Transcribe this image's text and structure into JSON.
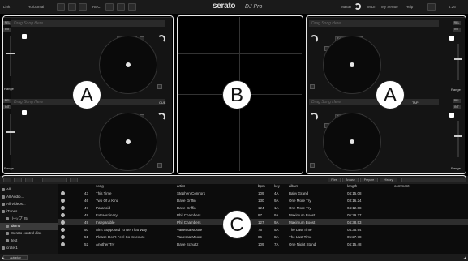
{
  "topbar": {
    "link": "Link",
    "layout": "Horizontal",
    "rec": "REC",
    "brand": "serato",
    "brand2": "DJ Pro",
    "master": "Master",
    "midi": "MIDI",
    "serato_db": "My Serato",
    "help": "Help",
    "clock": "4:26"
  },
  "decks": [
    {
      "title": "Drag Song Here",
      "rel": "REL",
      "int": "INT",
      "sync": "SYNC",
      "range": "Range",
      "extra": ""
    },
    {
      "title": "Drag Song Here",
      "rel": "REL",
      "int": "INT",
      "sync": "SYNC",
      "range": "Range",
      "extra": "CUE"
    },
    {
      "title": "Drag Song Here",
      "rel": "REL",
      "int": "INT",
      "sync": "SYNC",
      "range": "Range",
      "extra": ""
    },
    {
      "title": "Drag Song Here",
      "rel": "REL",
      "int": "INT",
      "sync": "SYNC",
      "range": "Range",
      "extra": "TAP"
    }
  ],
  "callouts": {
    "a_left": "A",
    "b": "B",
    "a_right": "A",
    "c": "C"
  },
  "library": {
    "tabs": [
      "Files",
      "Browse",
      "Prepare",
      "History"
    ],
    "headers": {
      "song": "song",
      "artist": "artist",
      "bpm": "bpm",
      "key": "key",
      "album": "album",
      "length": "length",
      "comment": "comment"
    },
    "sidebar": [
      "All...",
      "All Audio...",
      "All Videos...",
      "iTunes",
      "トップ 25",
      "demo",
      "Serato control disc",
      "test",
      "crate 1"
    ],
    "rows": [
      {
        "num": "43",
        "song": "This Time",
        "artist": "Stephen Connors",
        "bpm": "109",
        "key": "4A",
        "album": "Baby Grand",
        "length": "04:15.08"
      },
      {
        "num": "46",
        "song": "Two Of A Kind",
        "artist": "Dave Griffin",
        "bpm": "130",
        "key": "9A",
        "album": "One More Try",
        "length": "03:16.24"
      },
      {
        "num": "47",
        "song": "Paranoid",
        "artist": "Dave Griffin",
        "bpm": "124",
        "key": "1A",
        "album": "One More Try",
        "length": "04:12.08"
      },
      {
        "num": "48",
        "song": "Extraordinary",
        "artist": "Phil Chambers",
        "bpm": "87",
        "key": "9A",
        "album": "Maximum Boost",
        "length": "05:29.27"
      },
      {
        "num": "49",
        "song": "Inseparable",
        "artist": "Phil Chambers",
        "bpm": "127",
        "key": "9A",
        "album": "Maximum Boost",
        "length": "04:38.53"
      },
      {
        "num": "50",
        "song": "Ain't Supposed To Be That Way",
        "artist": "Vanessa Moore",
        "bpm": "76",
        "key": "5A",
        "album": "The Last Time",
        "length": "04:35.94"
      },
      {
        "num": "51",
        "song": "Please Don't Feel So Insecure",
        "artist": "Vanessa Moore",
        "bpm": "86",
        "key": "8A",
        "album": "The Last Time",
        "length": "05:27.78"
      },
      {
        "num": "52",
        "song": "Another Try",
        "artist": "Dave Schultz",
        "bpm": "109",
        "key": "7A",
        "album": "One Night Stand",
        "length": "04:15.48"
      }
    ],
    "autoplay": "Autoplay"
  }
}
